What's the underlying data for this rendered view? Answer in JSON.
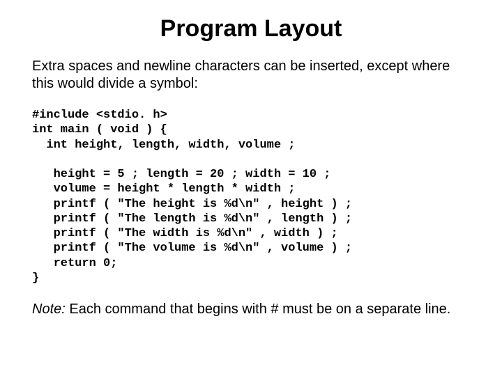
{
  "title": "Program Layout",
  "intro": "Extra spaces and newline characters can be inserted, except where this would divide a symbol:",
  "code": "#include <stdio. h>\nint main ( void ) {\n  int height, length, width, volume ;\n\n   height = 5 ; length = 20 ; width = 10 ;\n   volume = height * length * width ;\n   printf ( \"The height is %d\\n\" , height ) ;\n   printf ( \"The length is %d\\n\" , length ) ;\n   printf ( \"The width is %d\\n\" , width ) ;\n   printf ( \"The volume is %d\\n\" , volume ) ;\n   return 0;\n}",
  "note_label": "Note:",
  "note_text": " Each command that begins with # must be on a separate line."
}
